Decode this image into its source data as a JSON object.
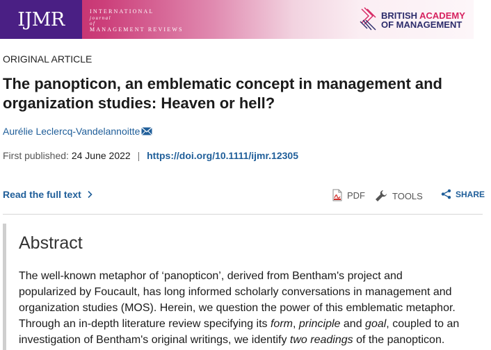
{
  "banner": {
    "journal_abbrev": "IJMR",
    "journal_name_line1": "International",
    "journal_name_line2": "journal",
    "journal_name_line3": "of",
    "journal_name_line4": "Management Reviews",
    "society_line1_a": "BRITISH ",
    "society_line1_b": "ACADEMY",
    "society_line2": "OF MANAGEMENT",
    "society_icon": "bam-crest-icon"
  },
  "article": {
    "type": "ORIGINAL ARTICLE",
    "title_line1": "The panopticon, an emblematic concept in management and",
    "title_line2": "organization studies: Heaven or hell?",
    "author": "Aurélie Leclercq-Vandelannoitte",
    "author_icon": "mail-icon",
    "first_published_label": "First published:",
    "first_published_date": "24 June 2022",
    "separator": "|",
    "doi": "https://doi.org/10.1111/ijmr.12305"
  },
  "actions": {
    "read_full_text": "Read the full text",
    "read_full_icon": "chevron-right-icon",
    "pdf_label": "PDF",
    "pdf_icon": "pdf-icon",
    "tools_label": "TOOLS",
    "tools_icon": "wrench-icon",
    "share_label": "SHARE",
    "share_icon": "share-icon"
  },
  "abstract": {
    "heading": "Abstract",
    "line1": "The well-known metaphor of ‘panopticon’, derived from Bentham's project and",
    "line2": "popularized by Foucault, has long informed scholarly conversations in management and",
    "line3": "organization studies (MOS). Herein, we question the power of this emblematic metaphor.",
    "line4_a": "Through an in-depth literature review specifying its ",
    "line4_form": "form",
    "line4_b": ", ",
    "line4_principle": "principle",
    "line4_c": " and ",
    "line4_goal": "goal",
    "line4_d": ", coupled to an",
    "line5_a": "investigation of Bentham's original writings, we identify ",
    "line5_em": "two readings",
    "line5_b": " of the panopticon."
  },
  "colors": {
    "link_blue": "#1f5e99",
    "banner_purple": "#4a1f84",
    "banner_magenta": "#b6165a",
    "bam_navy": "#2c2c6b",
    "bam_red": "#d6225f"
  }
}
